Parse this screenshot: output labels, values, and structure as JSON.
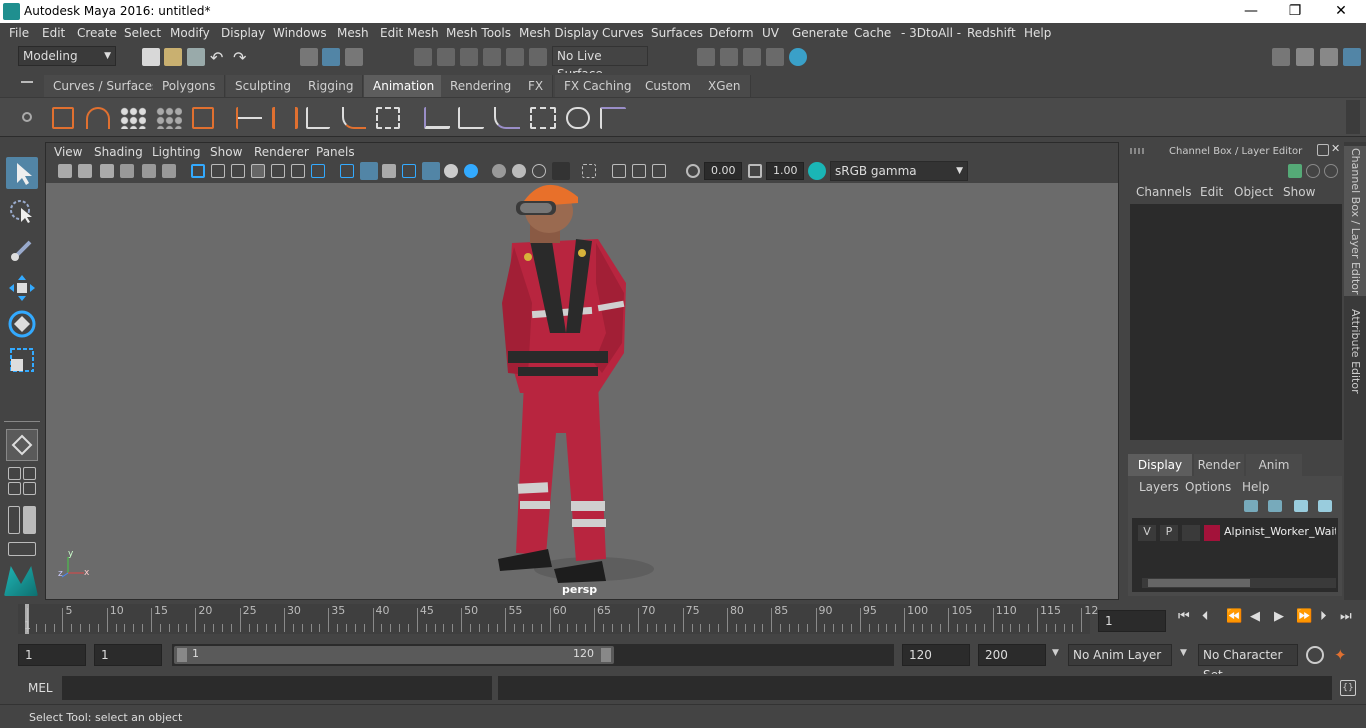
{
  "window": {
    "title": "Autodesk Maya 2016: untitled*",
    "minimize": "—",
    "maximize": "❐",
    "close": "✕"
  },
  "menu": [
    "File",
    "Edit",
    "Create",
    "Select",
    "Modify",
    "Display",
    "Windows",
    "Mesh",
    "Edit Mesh",
    "Mesh Tools",
    "Mesh Display",
    "Curves",
    "Surfaces",
    "Deform",
    "UV",
    "Generate",
    "Cache",
    "- 3DtoAll -",
    "Redshift",
    "Help"
  ],
  "statusline": {
    "mode": "Modeling",
    "live_surface": "No Live Surface"
  },
  "shelf_tabs": [
    "Curves / Surfaces",
    "Polygons",
    "Sculpting",
    "Rigging",
    "Animation",
    "Rendering",
    "FX",
    "FX Caching",
    "Custom",
    "XGen"
  ],
  "shelf_active": "Animation",
  "panel_menu": [
    "View",
    "Shading",
    "Lighting",
    "Show",
    "Renderer",
    "Panels"
  ],
  "panel_bar": {
    "exposure": "0.00",
    "gamma": "1.00",
    "colorspace": "sRGB gamma"
  },
  "viewport": {
    "camera_label": "persp",
    "axis_x": "x",
    "axis_y": "y",
    "axis_z": "z"
  },
  "channelbox": {
    "title": "Channel Box / Layer Editor",
    "menu": [
      "Channels",
      "Edit",
      "Object",
      "Show"
    ],
    "layer_tabs": [
      "Display",
      "Render",
      "Anim"
    ],
    "layer_tab_active": "Display",
    "layer_menu": [
      "Layers",
      "Options",
      "Help"
    ],
    "layer": {
      "v": "V",
      "p": "P",
      "name": "Alpinist_Worker_Waiti",
      "color": "#a3123a"
    }
  },
  "side_tabs": [
    "Channel Box / Layer Editor",
    "Attribute Editor"
  ],
  "timeline": {
    "labels": [
      "1",
      "5",
      "10",
      "15",
      "20",
      "25",
      "30",
      "35",
      "40",
      "45",
      "50",
      "55",
      "60",
      "65",
      "70",
      "75",
      "80",
      "85",
      "90",
      "95",
      "100",
      "105",
      "110",
      "115",
      "12"
    ],
    "current_frame": "1"
  },
  "range": {
    "start": "1",
    "current": "1",
    "slider_start": "1",
    "slider_end": "120",
    "end": "120",
    "max": "200",
    "anim_layer": "No Anim Layer",
    "char_set": "No Character Set"
  },
  "cmdline": {
    "lang": "MEL"
  },
  "helpline": {
    "text": "Select Tool: select an object"
  },
  "colors": {
    "accent": "#5d9fd8",
    "highlight": "#5285a6",
    "scene_bg": "#6b6b6b",
    "suit": "#b8253f",
    "helmet": "#e8702a"
  }
}
